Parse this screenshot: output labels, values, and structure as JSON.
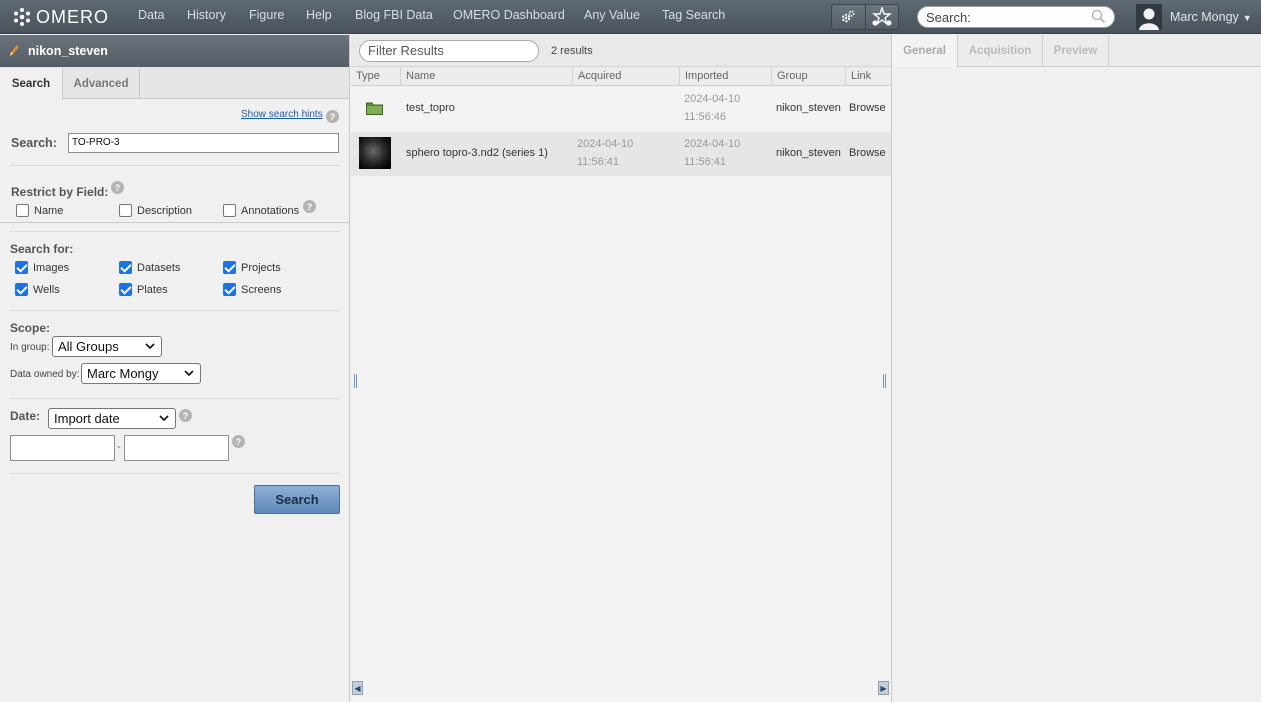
{
  "topbar": {
    "logo_text": "OMERO",
    "nav": [
      "Data",
      "History",
      "Figure",
      "Help",
      "Blog FBI Data",
      "OMERO Dashboard",
      "Any Value",
      "Tag Search"
    ],
    "search_placeholder": "Search:",
    "user_name": "Marc Mongy"
  },
  "left": {
    "header_title": "nikon_steven",
    "tabs": [
      "Search",
      "Advanced"
    ],
    "show_hints": "Show search hints",
    "search_label": "Search:",
    "search_value": "TO-PRO-3",
    "restrict_label": "Restrict by Field:",
    "restrict_fields": [
      {
        "label": "Name",
        "checked": false
      },
      {
        "label": "Description",
        "checked": false
      },
      {
        "label": "Annotations",
        "checked": false
      }
    ],
    "search_for_label": "Search for:",
    "search_for": [
      {
        "label": "Images",
        "checked": true
      },
      {
        "label": "Datasets",
        "checked": true
      },
      {
        "label": "Projects",
        "checked": true
      },
      {
        "label": "Wells",
        "checked": true
      },
      {
        "label": "Plates",
        "checked": true
      },
      {
        "label": "Screens",
        "checked": true
      }
    ],
    "scope_label": "Scope:",
    "in_group_label": "In group:",
    "in_group_value": "All Groups",
    "owned_by_label": "Data owned by:",
    "owned_by_value": "Marc Mongy",
    "date_label": "Date:",
    "date_type_value": "Import date",
    "date_sep": "-",
    "search_button": "Search"
  },
  "center": {
    "filter_placeholder": "Filter Results",
    "results_count": "2 results",
    "columns": [
      "Type",
      "Name",
      "Acquired",
      "Imported",
      "Group",
      "Link"
    ],
    "rows": [
      {
        "type_icon": "dataset-folder-icon",
        "name": "test_topro",
        "acquired": "",
        "imported_date": "2024-04-10",
        "imported_time": "11:56:46",
        "group": "nikon_steven",
        "link": "Browse"
      },
      {
        "type_icon": "image-thumbnail",
        "name": "sphero topro-3.nd2 (series 1)",
        "acquired_date": "2024-04-10",
        "acquired_time": "11:56:41",
        "imported_date": "2024-04-10",
        "imported_time": "11:56:41",
        "group": "nikon_steven",
        "link": "Browse"
      }
    ]
  },
  "right": {
    "tabs": [
      "General",
      "Acquisition",
      "Preview"
    ]
  }
}
